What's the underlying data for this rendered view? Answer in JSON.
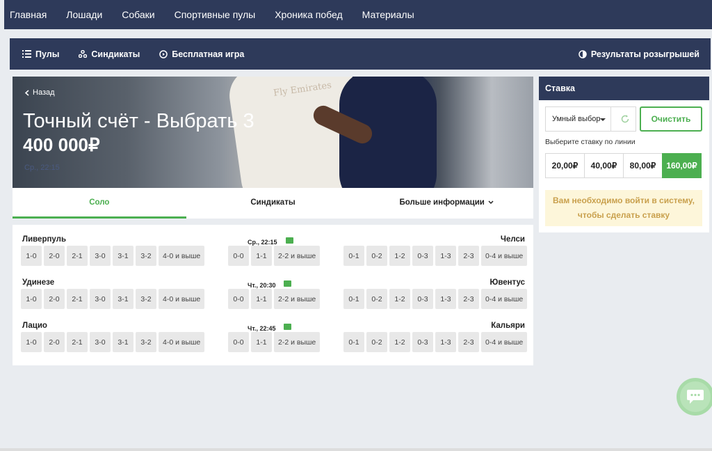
{
  "topnav": [
    "Главная",
    "Лошади",
    "Собаки",
    "Спортивные пулы",
    "Хроника побед",
    "Материалы"
  ],
  "subnav": {
    "pools": "Пулы",
    "syndicates": "Синдикаты",
    "free_game": "Бесплатная игра",
    "results": "Результаты розыгрышей"
  },
  "hero": {
    "back": "Назад",
    "title": "Точный счёт - Выбрать 3",
    "prize": "400 000₽",
    "date": "Ср., 22:15",
    "shirt_text": "Fly Emirates"
  },
  "tabs": {
    "solo": "Соло",
    "syndicates": "Синдикаты",
    "more": "Больше информации"
  },
  "matches": [
    {
      "home": "Ливерпуль",
      "away": "Челси",
      "time": "Ср., 22:15"
    },
    {
      "home": "Удинезе",
      "away": "Ювентус",
      "time": "Чт., 20:30"
    },
    {
      "home": "Лацио",
      "away": "Кальяри",
      "time": "Чт., 22:45"
    }
  ],
  "picks": {
    "home": [
      "1-0",
      "2-0",
      "2-1",
      "3-0",
      "3-1",
      "3-2",
      "4-0 и выше"
    ],
    "draw": [
      "0-0",
      "1-1",
      "2-2 и выше"
    ],
    "away": [
      "0-1",
      "0-2",
      "1-2",
      "0-3",
      "1-3",
      "2-3",
      "0-4 и выше"
    ]
  },
  "panel": {
    "title": "Ставка",
    "smart_pick": "Умный выбор",
    "clear": "Очистить",
    "hint": "Выберите ставку по линии",
    "stakes": [
      "20,00₽",
      "40,00₽",
      "80,00₽",
      "160,00₽"
    ],
    "selected_stake": "160,00₽",
    "login_line1": "Вам необходимо войти в систему,",
    "login_line2": "чтобы сделать ставку"
  },
  "colors": {
    "nav": "#2e3a5a",
    "accent": "#4caf50",
    "warning_bg": "#fdf6da",
    "warning_text": "#c9a04d"
  }
}
